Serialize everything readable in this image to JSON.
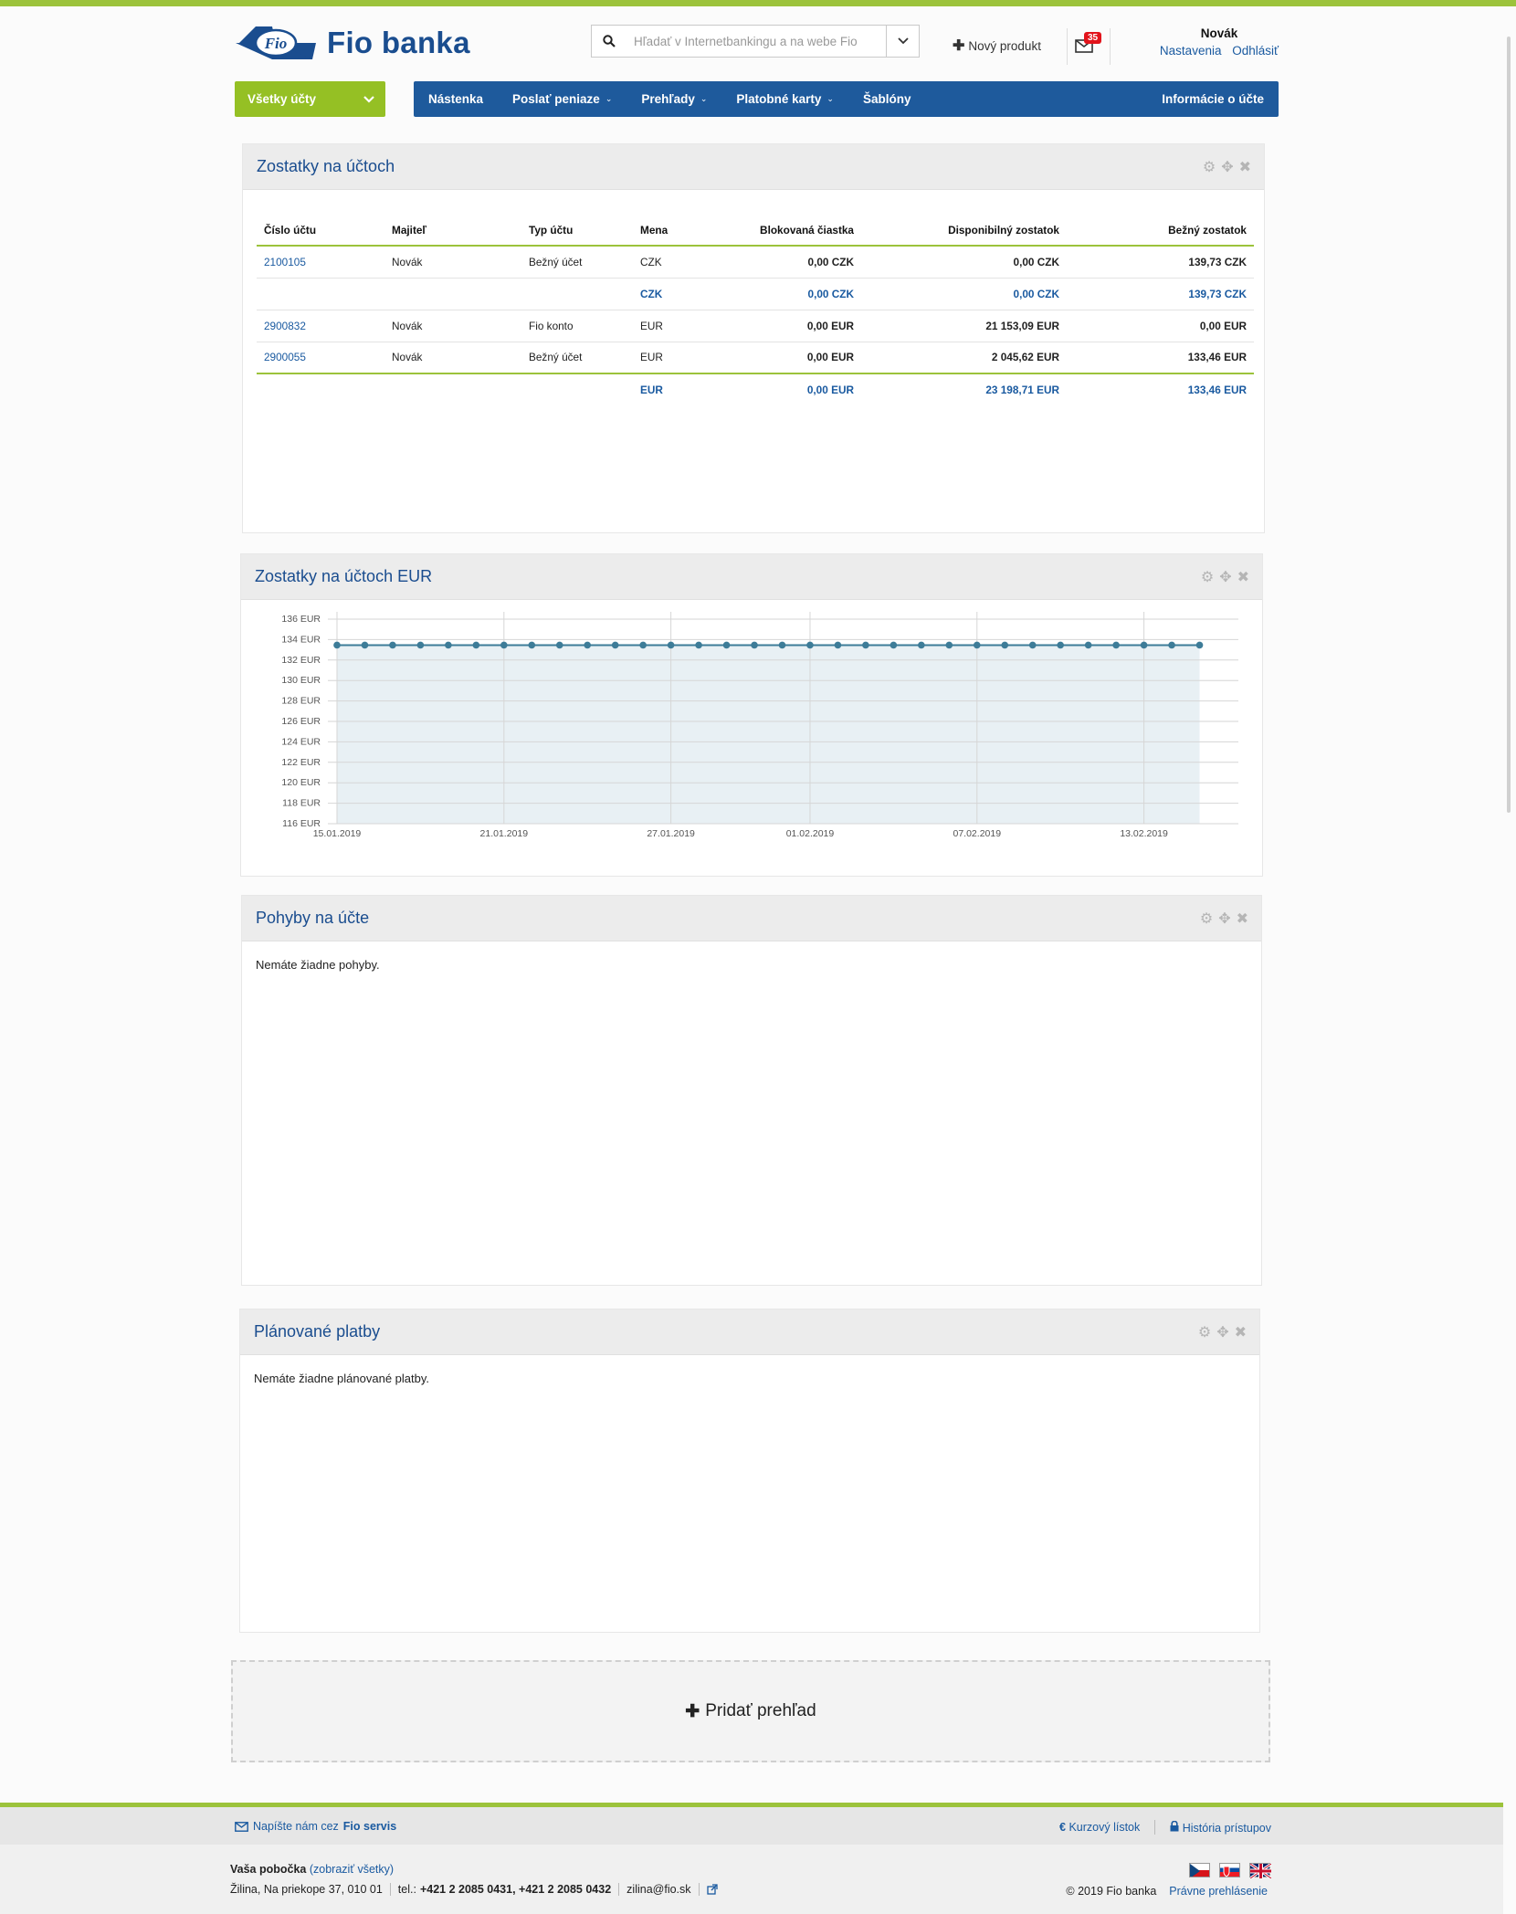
{
  "header": {
    "logo_mark": "Fio",
    "logo_text": "Fio banka",
    "search_placeholder": "Hľadať v Internetbankingu a na webe Fio",
    "new_product": "Nový produkt",
    "mail_count": "35",
    "user_name": "Novák",
    "settings_link": "Nastavenia",
    "logout_link": "Odhlásiť"
  },
  "nav": {
    "account_select": "Všetky účty",
    "items": [
      "Nástenka",
      "Poslať peniaze",
      "Prehľady",
      "Platobné karty",
      "Šablóny"
    ],
    "right_item": "Informácie o účte"
  },
  "balances": {
    "title": "Zostatky na účtoch",
    "headers": [
      "Číslo účtu",
      "Majiteľ",
      "Typ účtu",
      "Mena",
      "Blokovaná čiastka",
      "Disponibilný zostatok",
      "Bežný zostatok"
    ],
    "rows": [
      {
        "account": "2100105",
        "owner": "Novák",
        "type": "Bežný účet",
        "currency": "CZK",
        "blocked": "0,00 CZK",
        "available": "0,00 CZK",
        "balance": "139,73 CZK"
      },
      {
        "account": "",
        "owner": "",
        "type": "",
        "currency": "CZK",
        "blocked": "0,00 CZK",
        "available": "0,00 CZK",
        "balance": "139,73 CZK"
      },
      {
        "account": "2900832",
        "owner": "Novák",
        "type": "Fio konto",
        "currency": "EUR",
        "blocked": "0,00 EUR",
        "available": "21 153,09 EUR",
        "balance": "0,00 EUR"
      },
      {
        "account": "2900055",
        "owner": "Novák",
        "type": "Bežný účet",
        "currency": "EUR",
        "blocked": "0,00 EUR",
        "available": "2 045,62 EUR",
        "balance": "133,46 EUR"
      },
      {
        "account": "",
        "owner": "",
        "type": "",
        "currency": "EUR",
        "blocked": "0,00 EUR",
        "available": "23 198,71 EUR",
        "balance": "133,46 EUR"
      }
    ]
  },
  "chart_panel": {
    "title": "Zostatky na účtoch EUR"
  },
  "chart_data": {
    "type": "area",
    "y_ticks": [
      "136 EUR",
      "134 EUR",
      "132 EUR",
      "130 EUR",
      "128 EUR",
      "126 EUR",
      "124 EUR",
      "122 EUR",
      "120 EUR",
      "118 EUR",
      "116 EUR"
    ],
    "ylim": [
      116,
      136
    ],
    "x_ticks": [
      "15.01.2019",
      "21.01.2019",
      "27.01.2019",
      "01.02.2019",
      "07.02.2019",
      "13.02.2019"
    ],
    "x_range": [
      "15.01.2019",
      "16.02.2019"
    ],
    "series": [
      {
        "values": [
          133.46,
          133.46,
          133.46,
          133.46,
          133.46,
          133.46,
          133.46,
          133.46,
          133.46,
          133.46,
          133.46,
          133.46,
          133.46,
          133.46,
          133.46,
          133.46,
          133.46,
          133.46,
          133.46,
          133.46,
          133.46,
          133.46,
          133.46,
          133.46,
          133.46,
          133.46,
          133.46,
          133.46,
          133.46,
          133.46,
          133.46,
          133.46
        ]
      }
    ],
    "grid": true,
    "line_color": "#3d7c98",
    "fill_color": "#e8f0f4"
  },
  "movements": {
    "title": "Pohyby na účte",
    "empty": "Nemáte žiadne pohyby."
  },
  "planned": {
    "title": "Plánované platby",
    "empty": "Nemáte žiadne plánované platby."
  },
  "add_panel": "Pridať prehľad",
  "footer": {
    "write_us": "Napíšte nám cez",
    "write_us_service": "Fio servis",
    "rates": "Kurzový lístok",
    "history": "História prístupov",
    "branch_label": "Vaša pobočka",
    "branch_link": "(zobraziť všetky)",
    "address": "Žilina, Na priekope 37, 010 01",
    "phone_label": "tel.:",
    "phones": "+421 2 2085 0431, +421 2 2085 0432",
    "email": "zilina@fio.sk",
    "copyright": "© 2019 Fio banka",
    "legal": "Právne prehlásenie"
  },
  "colors": {
    "brand_blue": "#1e5a9c",
    "brand_green": "#9cc33b",
    "badge_red": "#e2131b"
  }
}
